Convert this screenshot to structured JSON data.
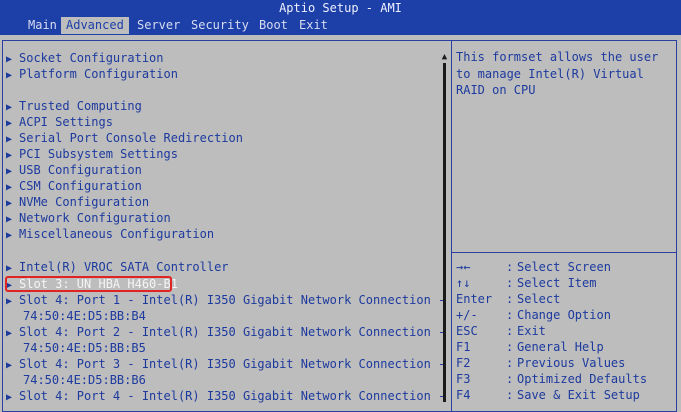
{
  "window": {
    "title": "Aptio Setup - AMI"
  },
  "menubar": {
    "items": [
      {
        "label": "Main"
      },
      {
        "label": "Advanced",
        "active": true
      },
      {
        "label": "Server"
      },
      {
        "label": "Security"
      },
      {
        "label": "Boot"
      },
      {
        "label": "Exit"
      }
    ]
  },
  "left_panel": {
    "items": [
      {
        "label": "Socket Configuration",
        "type": "submenu"
      },
      {
        "label": "Platform Configuration",
        "type": "submenu"
      },
      {
        "label": "Trusted Computing",
        "type": "submenu"
      },
      {
        "label": "ACPI Settings",
        "type": "submenu"
      },
      {
        "label": "Serial Port Console Redirection",
        "type": "submenu"
      },
      {
        "label": "PCI Subsystem Settings",
        "type": "submenu"
      },
      {
        "label": "USB Configuration",
        "type": "submenu"
      },
      {
        "label": "CSM Configuration",
        "type": "submenu"
      },
      {
        "label": "NVMe Configuration",
        "type": "submenu"
      },
      {
        "label": "Network Configuration",
        "type": "submenu"
      },
      {
        "label": "Miscellaneous Configuration",
        "type": "submenu"
      },
      {
        "label": "Intel(R) VROC SATA Controller",
        "type": "submenu"
      },
      {
        "label": "Slot 3: UN HBA H460-B1",
        "type": "submenu",
        "selected": true
      },
      {
        "label": "Slot 4: Port 1 - Intel(R) I350 Gigabit Network Connection -",
        "type": "submenu"
      },
      {
        "label": "74:50:4E:D5:BB:B4",
        "type": "static"
      },
      {
        "label": "Slot 4: Port 2 - Intel(R) I350 Gigabit Network Connection -",
        "type": "submenu"
      },
      {
        "label": "74:50:4E:D5:BB:B5",
        "type": "static"
      },
      {
        "label": "Slot 4: Port 3 - Intel(R) I350 Gigabit Network Connection -",
        "type": "submenu"
      },
      {
        "label": "74:50:4E:D5:BB:B6",
        "type": "static"
      },
      {
        "label": "Slot 4: Port 4 - Intel(R) I350 Gigabit Network Connection -",
        "type": "submenu"
      }
    ]
  },
  "help_panel": {
    "lines": [
      "This formset allows the user",
      "to manage Intel(R) Virtual",
      "RAID on CPU"
    ]
  },
  "key_legend": {
    "separator": ":",
    "items": [
      {
        "key": "→←",
        "desc": "Select Screen"
      },
      {
        "key": "↑↓",
        "desc": "Select Item"
      },
      {
        "key": "Enter",
        "desc": "Select"
      },
      {
        "key": "+/-",
        "desc": "Change Option"
      },
      {
        "key": "ESC",
        "desc": "Exit"
      },
      {
        "key": "F1",
        "desc": "General Help"
      },
      {
        "key": "F2",
        "desc": "Previous Values"
      },
      {
        "key": "F3",
        "desc": "Optimized Defaults"
      },
      {
        "key": "F4",
        "desc": "Save & Exit Setup"
      }
    ]
  },
  "colors": {
    "header_bg": "#1d3fa8",
    "panel_bg": "#bdbdbd",
    "text": "#1d3a9e",
    "selected_text": "#f5f5f5",
    "highlight_box": "#e02424"
  }
}
